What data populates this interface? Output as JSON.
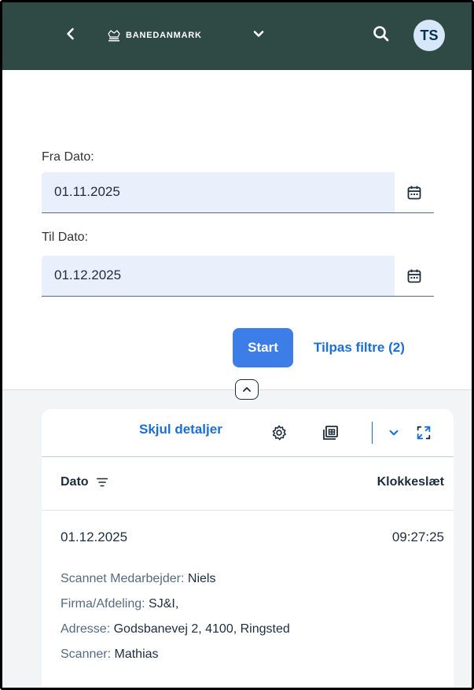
{
  "shell": {
    "brand": "BANEDANMARK",
    "avatar_initials": "TS"
  },
  "filters": {
    "from_label": "Fra Dato:",
    "from_value": "01.11.2025",
    "to_label": "Til Dato:",
    "to_value": "01.12.2025",
    "start_label": "Start",
    "adapt_label": "Tilpas filtre (2)"
  },
  "toolbar": {
    "hide_details_label": "Skjul detaljer"
  },
  "table": {
    "columns": [
      "Dato",
      "Klokkeslæt"
    ],
    "rows": [
      {
        "date": "01.12.2025",
        "time": "09:27:25",
        "details": [
          {
            "key": "Scannet Medarbejder:",
            "value": "Niels"
          },
          {
            "key": "Firma/Afdeling:",
            "value": "SJ&I,"
          },
          {
            "key": "Adresse:",
            "value": "Godsbanevej 2, 4100, Ringsted"
          },
          {
            "key": "Scanner:",
            "value": "Mathias"
          }
        ]
      }
    ]
  },
  "colors": {
    "shell_bg": "#2f4a45",
    "accent": "#1a6ed8",
    "primary_button": "#3d7de8",
    "field_bg": "#eaf0fb"
  }
}
